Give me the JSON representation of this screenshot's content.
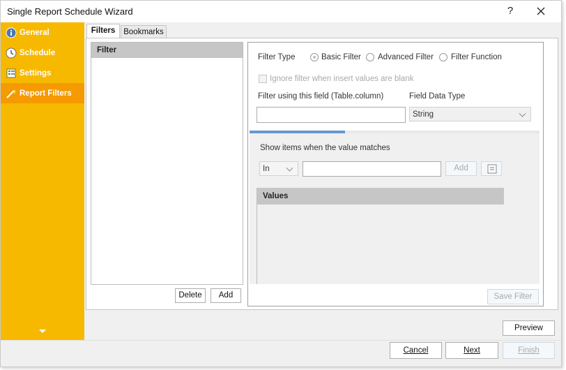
{
  "window": {
    "title": "Single Report Schedule Wizard",
    "help": "?"
  },
  "sidebar": {
    "items": [
      {
        "label": "General",
        "icon": "info-icon"
      },
      {
        "label": "Schedule",
        "icon": "clock-icon"
      },
      {
        "label": "Settings",
        "icon": "settings-list-icon"
      },
      {
        "label": "Report Filters",
        "icon": "filter-wand-icon"
      }
    ]
  },
  "tabs": [
    {
      "label": "Filters"
    },
    {
      "label": "Bookmarks"
    }
  ],
  "filter_list": {
    "header": "Filter",
    "delete_label": "Delete",
    "add_label": "Add"
  },
  "filter_form": {
    "filter_type_label": "Filter Type",
    "options": [
      {
        "label": "Basic Filter"
      },
      {
        "label": "Advanced Filter"
      },
      {
        "label": "Filter Function"
      }
    ],
    "ignore_blank_label": "Ignore filter when insert values are blank",
    "field_label": "Filter using this field (Table.column)",
    "field_value": "",
    "data_type_label": "Field Data Type",
    "data_type_value": "String",
    "progress": 0.33,
    "match_label": "Show items when the value matches",
    "operator_value": "In",
    "match_value": "",
    "add_label": "Add",
    "values_header": "Values",
    "save_filter_label": "Save Filter"
  },
  "footer": {
    "preview_label": "Preview",
    "cancel_label": "Cancel",
    "next_label": "Next",
    "finish_label": "Finish"
  },
  "colors": {
    "sidebar": "#f7b900",
    "sidebar_active": "#f59a00",
    "progress": "#6699cc"
  }
}
